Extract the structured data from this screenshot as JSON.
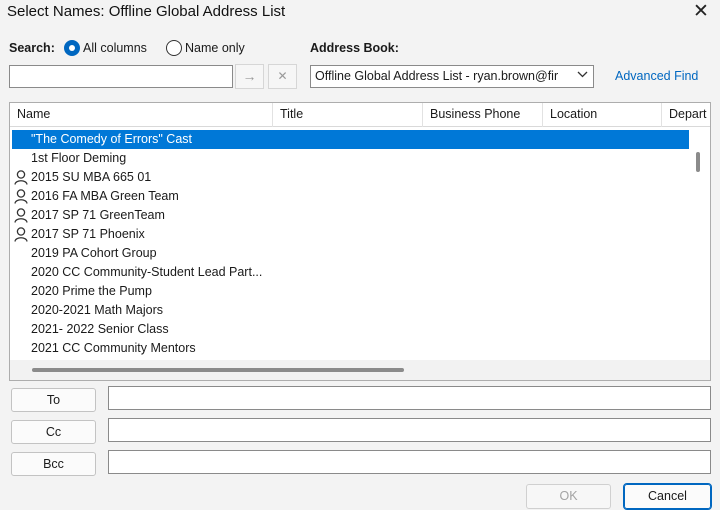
{
  "window": {
    "title": "Select Names: Offline Global Address List",
    "close_glyph": "✕"
  },
  "search": {
    "label": "Search:",
    "options": [
      {
        "label": "All columns",
        "selected": true
      },
      {
        "label": "Name only",
        "selected": false
      }
    ],
    "value": "",
    "go_glyph": "→",
    "clear_glyph": "✕"
  },
  "address_book": {
    "label": "Address Book:",
    "selected": "Offline Global Address List - ryan.brown@fir",
    "advanced_find": "Advanced Find"
  },
  "list": {
    "columns": [
      "Name",
      "Title",
      "Business Phone",
      "Location",
      "Depart"
    ],
    "rows": [
      {
        "name": "\"The Comedy of Errors\" Cast",
        "person_icon": false,
        "selected": true
      },
      {
        "name": "1st Floor Deming",
        "person_icon": false,
        "selected": false
      },
      {
        "name": "2015 SU MBA 665 01",
        "person_icon": true,
        "selected": false
      },
      {
        "name": "2016 FA MBA Green Team",
        "person_icon": true,
        "selected": false
      },
      {
        "name": "2017 SP 71 GreenTeam",
        "person_icon": true,
        "selected": false
      },
      {
        "name": "2017 SP 71 Phoenix",
        "person_icon": true,
        "selected": false
      },
      {
        "name": "2019 PA Cohort Group",
        "person_icon": false,
        "selected": false
      },
      {
        "name": "2020 CC Community-Student Lead Part...",
        "person_icon": false,
        "selected": false
      },
      {
        "name": "2020 Prime the Pump",
        "person_icon": false,
        "selected": false
      },
      {
        "name": "2020-2021 Math Majors",
        "person_icon": false,
        "selected": false
      },
      {
        "name": "2021- 2022 Senior Class",
        "person_icon": false,
        "selected": false
      },
      {
        "name": "2021 CC Community Mentors",
        "person_icon": false,
        "selected": false
      }
    ]
  },
  "recipients": {
    "to_label": "To",
    "cc_label": "Cc",
    "bcc_label": "Bcc",
    "to_value": "",
    "cc_value": "",
    "bcc_value": ""
  },
  "buttons": {
    "ok": "OK",
    "ok_enabled": false,
    "cancel": "Cancel"
  },
  "colors": {
    "accent": "#0067c0",
    "selection": "#0078d7"
  }
}
